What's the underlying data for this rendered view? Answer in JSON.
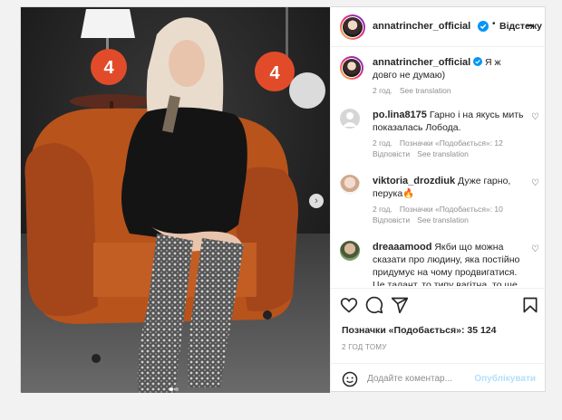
{
  "post": {
    "username": "annatrincher_official",
    "follow_label": "Відстежу",
    "more_label": "•••",
    "caption": "Я ж довго не думаю)",
    "caption_time": "2 год.",
    "see_translation": "See translation"
  },
  "comments": [
    {
      "username": "po.lina8175",
      "text": "Гарно і на якусь мить показалась Лобода.",
      "time": "2 год.",
      "likes": "Позначки «Подобається»: 12",
      "reply": "Відповісти",
      "translate": "See translation"
    },
    {
      "username": "viktoria_drozdiuk",
      "text": "Дуже гарно, перука🔥",
      "time": "2 год.",
      "likes": "Позначки «Подобається»: 10",
      "reply": "Відповісти",
      "translate": "See translation"
    },
    {
      "username": "dreaaamood",
      "text": "Якби що можна сказати про людину, яка постійно придумує на чому продвигатися. Це талант, то типу вагітна, то ще"
    }
  ],
  "footer": {
    "likes": "Позначки «Подобається»: 35 124",
    "time": "2 ГОД ТОМУ",
    "add_comment_placeholder": "Додайте коментар...",
    "post_label": "Опублікувати"
  },
  "media": {
    "sign_text": "4"
  },
  "colors": {
    "verified": "#0095f6",
    "link": "#0095f6",
    "post_disabled": "#b2dffc",
    "armchair": "#b8531c"
  },
  "icons": [
    "heart-icon",
    "comment-icon",
    "share-icon",
    "bookmark-icon",
    "emoji-icon",
    "verified-icon",
    "more-icon",
    "chevron-right-icon"
  ]
}
